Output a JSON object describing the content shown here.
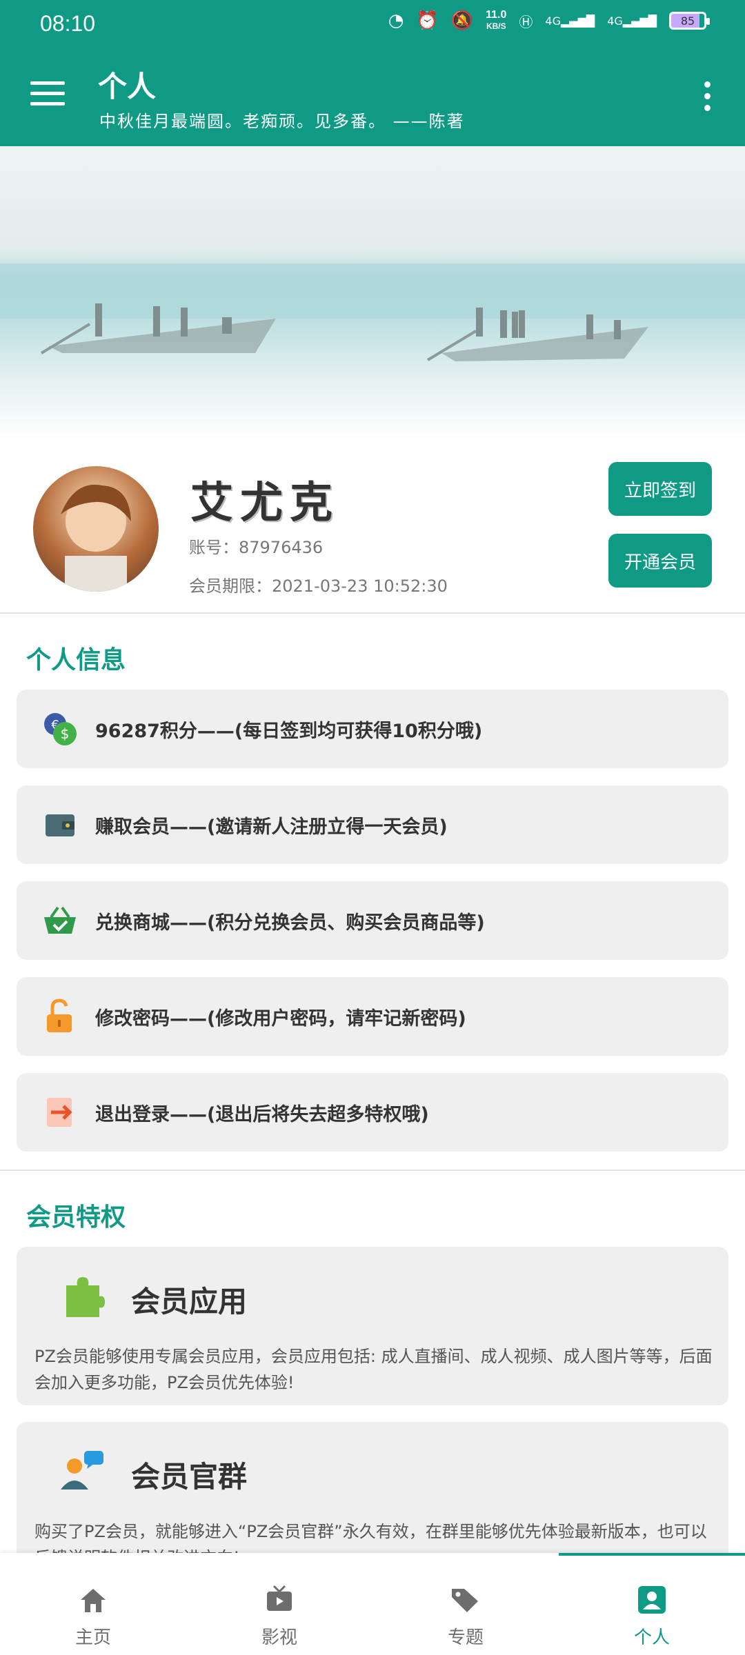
{
  "status_bar": {
    "time": "08:10",
    "net_speed_value": "11.0",
    "net_speed_unit": "KB/S",
    "signal_1": "4G",
    "signal_2": "4G",
    "battery": "85"
  },
  "app_bar": {
    "title": "个人",
    "subtitle": "中秋佳月最端圆。老痴顽。见多番。 ——陈著"
  },
  "profile": {
    "username": "艾尤克",
    "account": "账号：87976436",
    "vip_expiry": "会员期限：2021-03-23 10:52:30",
    "checkin_label": "立即签到",
    "open_vip_label": "开通会员"
  },
  "personal_info": {
    "title": "个人信息",
    "items": [
      {
        "label": "96287积分——(每日签到均可获得10积分哦)",
        "icon": "coins-icon"
      },
      {
        "label": "赚取会员——(邀请新人注册立得一天会员)",
        "icon": "wallet-icon"
      },
      {
        "label": "兑换商城——(积分兑换会员、购买会员商品等)",
        "icon": "basket-icon"
      },
      {
        "label": "修改密码——(修改用户密码，请牢记新密码)",
        "icon": "lock-open-icon"
      },
      {
        "label": "退出登录——(退出后将失去超多特权哦)",
        "icon": "logout-arrow-icon"
      }
    ]
  },
  "privileges": {
    "title": "会员特权",
    "cards": [
      {
        "title": "会员应用",
        "icon": "puzzle-icon",
        "desc": "PZ会员能够使用专属会员应用，会员应用包括: 成人直播间、成人视频、成人图片等等，后面会加入更多功能，PZ会员优先体验!"
      },
      {
        "title": "会员官群",
        "icon": "group-chat-icon",
        "desc": "购买了PZ会员，就能够进入“PZ会员官群”永久有效，在群里能够优先体验最新版本，也可以反馈说明软件相关改进方向!"
      }
    ]
  },
  "bottom_nav": {
    "items": [
      {
        "label": "主页",
        "icon": "home-icon"
      },
      {
        "label": "影视",
        "icon": "tv-icon"
      },
      {
        "label": "专题",
        "icon": "tags-icon"
      },
      {
        "label": "个人",
        "icon": "person-icon"
      }
    ],
    "active_index": 3
  },
  "colors": {
    "primary": "#0f9a86",
    "card_bg": "#efefef"
  }
}
